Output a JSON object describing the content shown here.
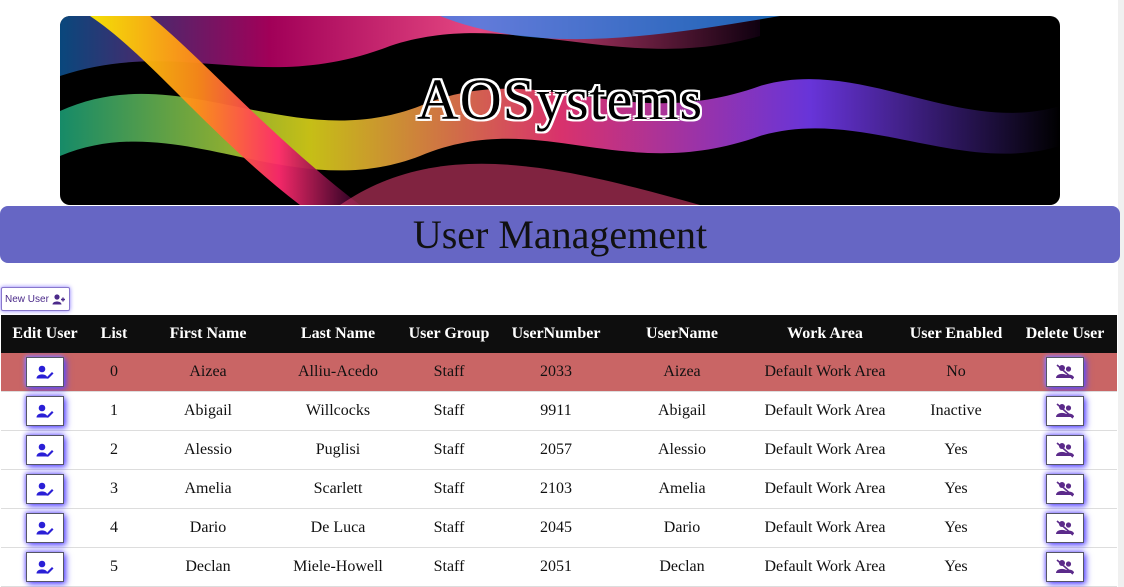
{
  "brand": {
    "logo_text": "AOSystems"
  },
  "page": {
    "title": "User Management"
  },
  "toolbar": {
    "new_user_label": "New User"
  },
  "table": {
    "headers": [
      "Edit User",
      "List",
      "First Name",
      "Last Name",
      "User Group",
      "UserNumber",
      "UserName",
      "Work Area",
      "User Enabled",
      "Delete User"
    ],
    "rows": [
      {
        "list": "0",
        "first": "Aizea",
        "last": "Alliu-Acedo",
        "group": "Staff",
        "number": "2033",
        "username": "Aizea",
        "area": "Default Work Area",
        "enabled": "No",
        "highlight": true
      },
      {
        "list": "1",
        "first": "Abigail",
        "last": "Willcocks",
        "group": "Staff",
        "number": "9911",
        "username": "Abigail",
        "area": "Default Work Area",
        "enabled": "Inactive",
        "highlight": false
      },
      {
        "list": "2",
        "first": "Alessio",
        "last": "Puglisi",
        "group": "Staff",
        "number": "2057",
        "username": "Alessio",
        "area": "Default Work Area",
        "enabled": "Yes",
        "highlight": false
      },
      {
        "list": "3",
        "first": "Amelia",
        "last": "Scarlett",
        "group": "Staff",
        "number": "2103",
        "username": "Amelia",
        "area": "Default Work Area",
        "enabled": "Yes",
        "highlight": false
      },
      {
        "list": "4",
        "first": "Dario",
        "last": "De Luca",
        "group": "Staff",
        "number": "2045",
        "username": "Dario",
        "area": "Default Work Area",
        "enabled": "Yes",
        "highlight": false
      },
      {
        "list": "5",
        "first": "Declan",
        "last": "Miele-Howell",
        "group": "Staff",
        "number": "2051",
        "username": "Declan",
        "area": "Default Work Area",
        "enabled": "Yes",
        "highlight": false
      }
    ]
  },
  "icons": {
    "edit": "user-edit-icon",
    "delete": "user-delete-icon",
    "new": "user-plus-icon"
  },
  "colors": {
    "title_bar": "#6666c4",
    "highlight_row": "#c96565",
    "header_bg": "#0e0e0e",
    "icon_accent": "#2a1fd6"
  }
}
